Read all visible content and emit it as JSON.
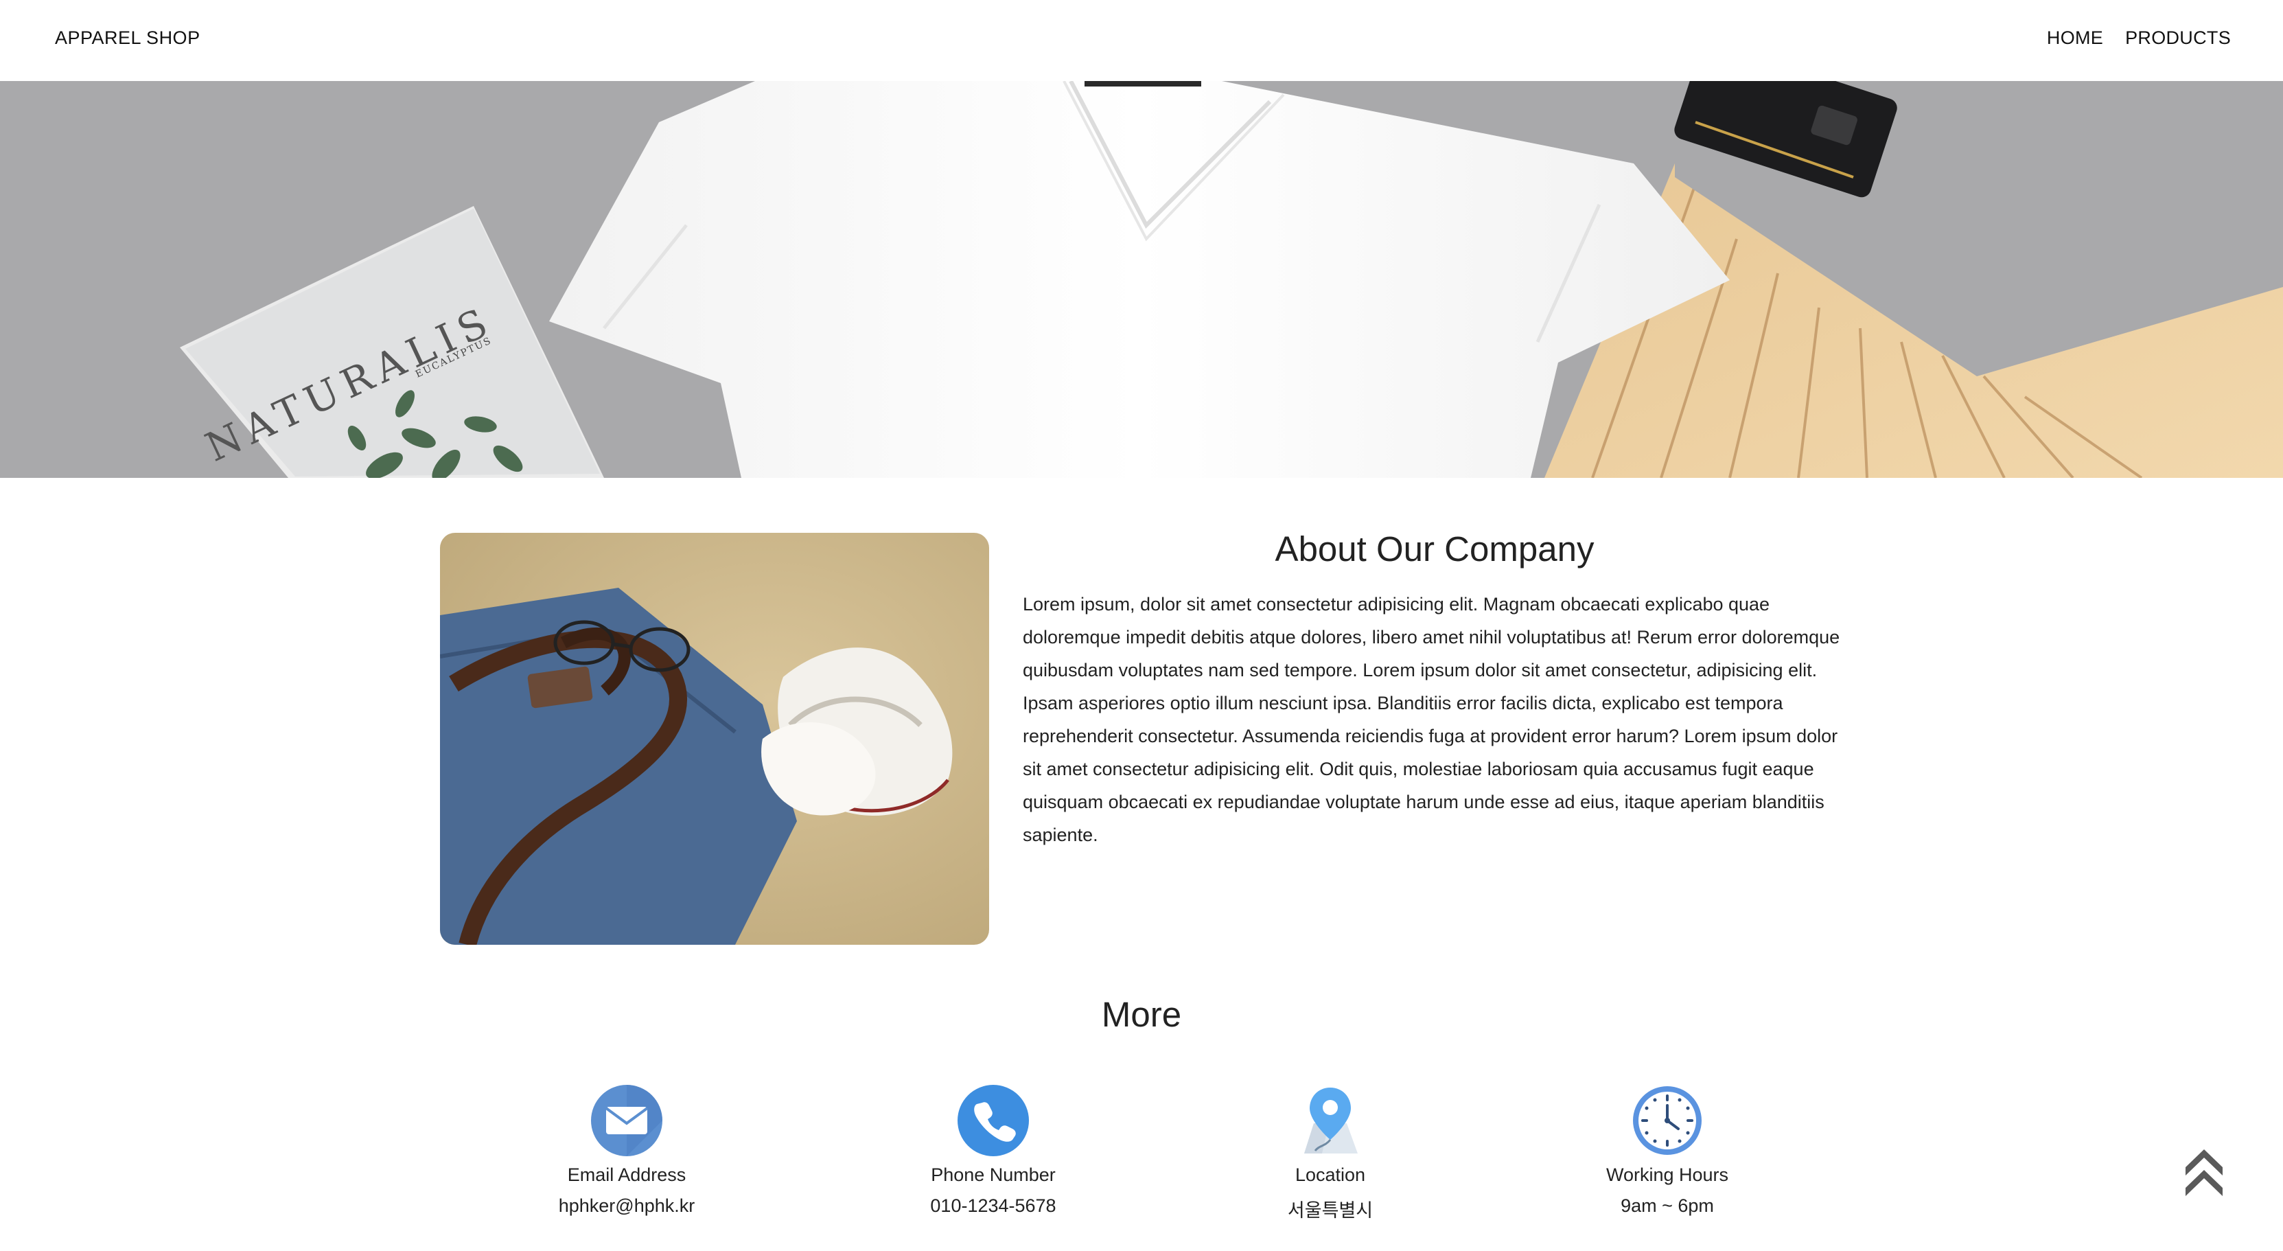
{
  "header": {
    "brand": "APPAREL SHOP",
    "nav": [
      {
        "label": "HOME"
      },
      {
        "label": "PRODUCTS"
      }
    ]
  },
  "hero": {
    "magazine_title": "NATURALIS",
    "magazine_subtitle": "EUCALYPTUS"
  },
  "about": {
    "title": "About Our Company",
    "body": "Lorem ipsum, dolor sit amet consectetur adipisicing elit. Magnam obcaecati explicabo quae doloremque impedit debitis atque dolores, libero amet nihil voluptatibus at! Rerum error doloremque quibusdam voluptates nam sed tempore. Lorem ipsum dolor sit amet consectetur, adipisicing elit. Ipsam asperiores optio illum nesciunt ipsa. Blanditiis error facilis dicta, explicabo est tempora reprehenderit consectetur. Assumenda reiciendis fuga at provident error harum? Lorem ipsum dolor sit amet consectetur adipisicing elit. Odit quis, molestiae laboriosam quia accusamus fugit eaque quisquam obcaecati ex repudiandae voluptate harum unde esse ad eius, itaque aperiam blanditiis sapiente."
  },
  "more": {
    "title": "More",
    "items": [
      {
        "icon": "email-icon",
        "label": "Email Address",
        "value": "hphker@hphk.kr"
      },
      {
        "icon": "phone-icon",
        "label": "Phone Number",
        "value": "010-1234-5678"
      },
      {
        "icon": "location-icon",
        "label": "Location",
        "value": "서울특별시"
      },
      {
        "icon": "clock-icon",
        "label": "Working Hours",
        "value": "9am ~ 6pm"
      }
    ]
  },
  "colors": {
    "accent_blue": "#4a90e2",
    "hero_gray": "#a9a9ab",
    "text": "#222222"
  }
}
